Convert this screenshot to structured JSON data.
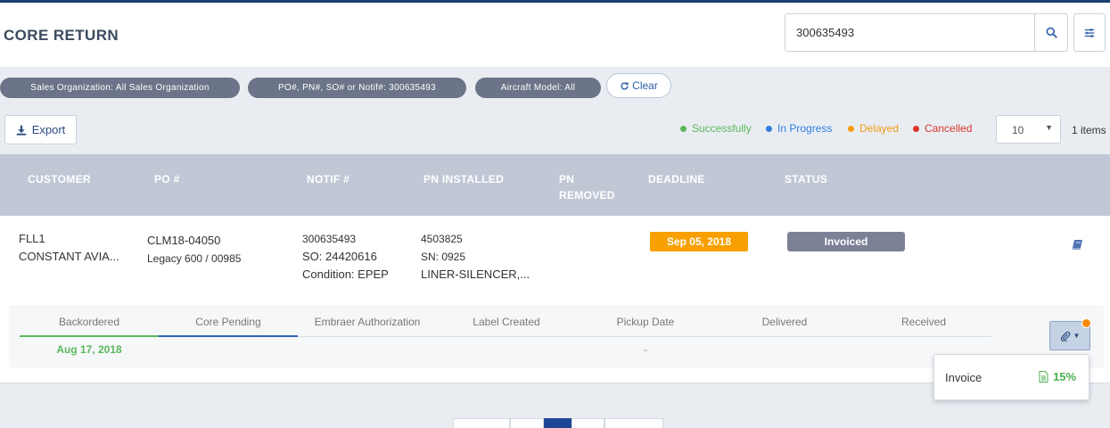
{
  "header": {
    "title": "CORE RETURN",
    "search_value": "300635493"
  },
  "filters": {
    "chips": [
      "Sales Organization: All Sales Organization",
      "PO#, PN#, SO# or Notif#: 300635493",
      "Aircraft Model: All"
    ],
    "clear_label": "Clear"
  },
  "toolbar": {
    "export_label": "Export",
    "legend": [
      {
        "label": "Successfully",
        "color": "#5cb85c"
      },
      {
        "label": "In Progress",
        "color": "#2f7fe0"
      },
      {
        "label": "Delayed",
        "color": "#f39c12"
      },
      {
        "label": "Cancelled",
        "color": "#d9342b"
      }
    ],
    "page_size": "10",
    "items_count": "1 items"
  },
  "table": {
    "columns": {
      "customer": "CUSTOMER",
      "po": "PO #",
      "notif": "NOTIF #",
      "pn_installed": "PN INSTALLED",
      "pn_removed": "PN REMOVED",
      "deadline": "DEADLINE",
      "status": "STATUS"
    },
    "row": {
      "customer_code": "FLL1",
      "customer_name": "CONSTANT AVIA...",
      "po_number": "CLM18-04050",
      "po_detail": "Legacy 600 / 00985",
      "notif_number": "300635493",
      "so": "SO: 24420616",
      "condition": "Condition: EPEP",
      "pn": "4503825",
      "sn": "SN: 0925",
      "description": "LINER-SILENCER,...",
      "deadline": "Sep 05, 2018",
      "status": "Invoiced"
    }
  },
  "tracker": {
    "steps": [
      {
        "label": "Backordered",
        "date": "Aug 17, 2018"
      },
      {
        "label": "Core Pending",
        "date": ""
      },
      {
        "label": "Embraer Authorization",
        "date": ""
      },
      {
        "label": "Label Created",
        "date": ""
      },
      {
        "label": "Pickup Date",
        "date": "-"
      },
      {
        "label": "Delivered",
        "date": ""
      },
      {
        "label": "Received",
        "date": ""
      }
    ]
  },
  "popover": {
    "item_label": "Invoice",
    "progress_label": "15%"
  }
}
